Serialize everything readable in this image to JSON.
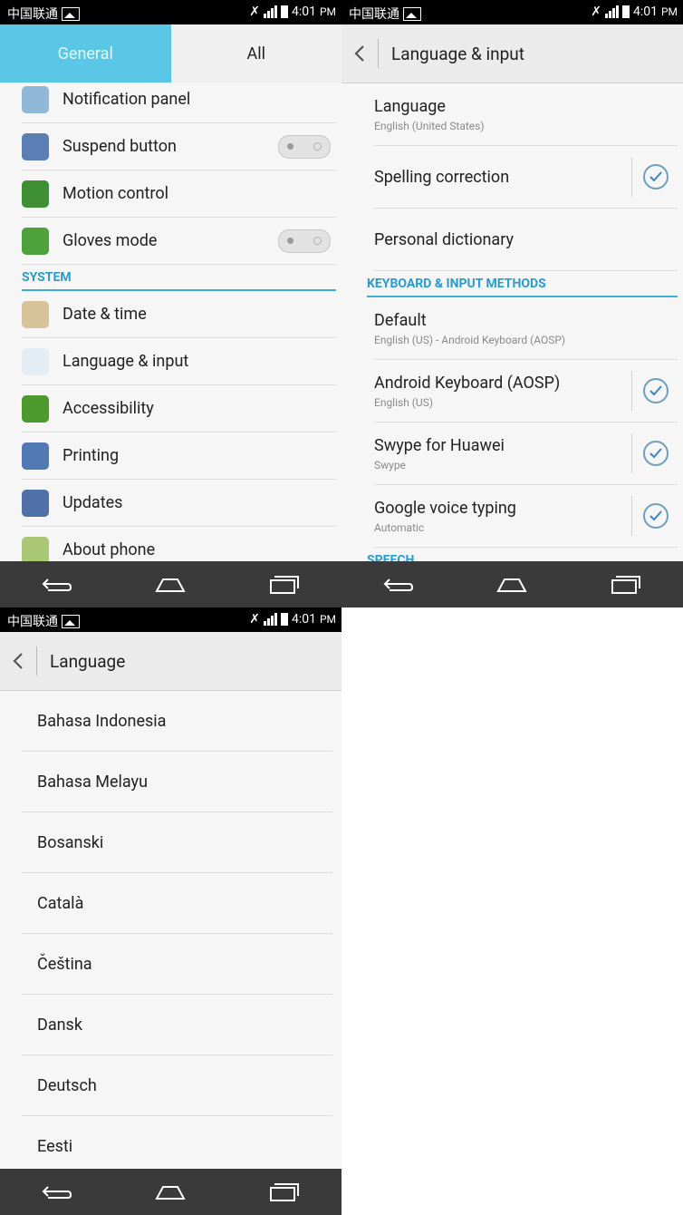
{
  "status": {
    "carrier": "中国联通",
    "time": "4:01",
    "ampm": "PM"
  },
  "screen1": {
    "tabs": {
      "general": "General",
      "all": "All"
    },
    "items_top": [
      {
        "label": "Notification panel",
        "icon": "notification-panel-icon",
        "color": "#8fb8d9",
        "toggle": false
      },
      {
        "label": "Suspend button",
        "icon": "suspend-button-icon",
        "color": "#5b7fb5",
        "toggle": true
      },
      {
        "label": "Motion control",
        "icon": "motion-control-icon",
        "color": "#3f8f36",
        "toggle": false
      },
      {
        "label": "Gloves mode",
        "icon": "gloves-mode-icon",
        "color": "#4fa23b",
        "toggle": true
      }
    ],
    "section": "SYSTEM",
    "items_system": [
      {
        "label": "Date & time",
        "icon": "clock-icon",
        "color": "#d8c29a"
      },
      {
        "label": "Language & input",
        "icon": "language-icon",
        "color": "#e4ecf6"
      },
      {
        "label": "Accessibility",
        "icon": "hand-icon",
        "color": "#4c9a2e"
      },
      {
        "label": "Printing",
        "icon": "printer-icon",
        "color": "#5279b4"
      },
      {
        "label": "Updates",
        "icon": "updates-icon",
        "color": "#5070a8"
      },
      {
        "label": "About phone",
        "icon": "info-icon",
        "color": "#a9c774"
      }
    ]
  },
  "screen2": {
    "title": "Language & input",
    "rows_a": [
      {
        "title": "Language",
        "subtitle": "English (United States)",
        "checked": false
      },
      {
        "title": "Spelling correction",
        "subtitle": "",
        "checked": true
      },
      {
        "title": "Personal dictionary",
        "subtitle": "",
        "checked": false
      }
    ],
    "section": "KEYBOARD & INPUT METHODS",
    "rows_b": [
      {
        "title": "Default",
        "subtitle": "English (US) - Android Keyboard (AOSP)",
        "checked": false
      },
      {
        "title": "Android Keyboard (AOSP)",
        "subtitle": "English (US)",
        "checked": true
      },
      {
        "title": "Swype for Huawei",
        "subtitle": "Swype",
        "checked": true
      },
      {
        "title": "Google voice typing",
        "subtitle": "Automatic",
        "checked": true
      }
    ],
    "section2": "SPEECH"
  },
  "screen3": {
    "title": "Language",
    "languages": [
      "Bahasa Indonesia",
      "Bahasa Melayu",
      "Bosanski",
      "Català",
      "Čeština",
      "Dansk",
      "Deutsch",
      "Eesti"
    ]
  },
  "colors": {
    "accent": "#2a9bcf",
    "tab_active": "#5ac7e6",
    "navbar": "#3a3a3a"
  }
}
